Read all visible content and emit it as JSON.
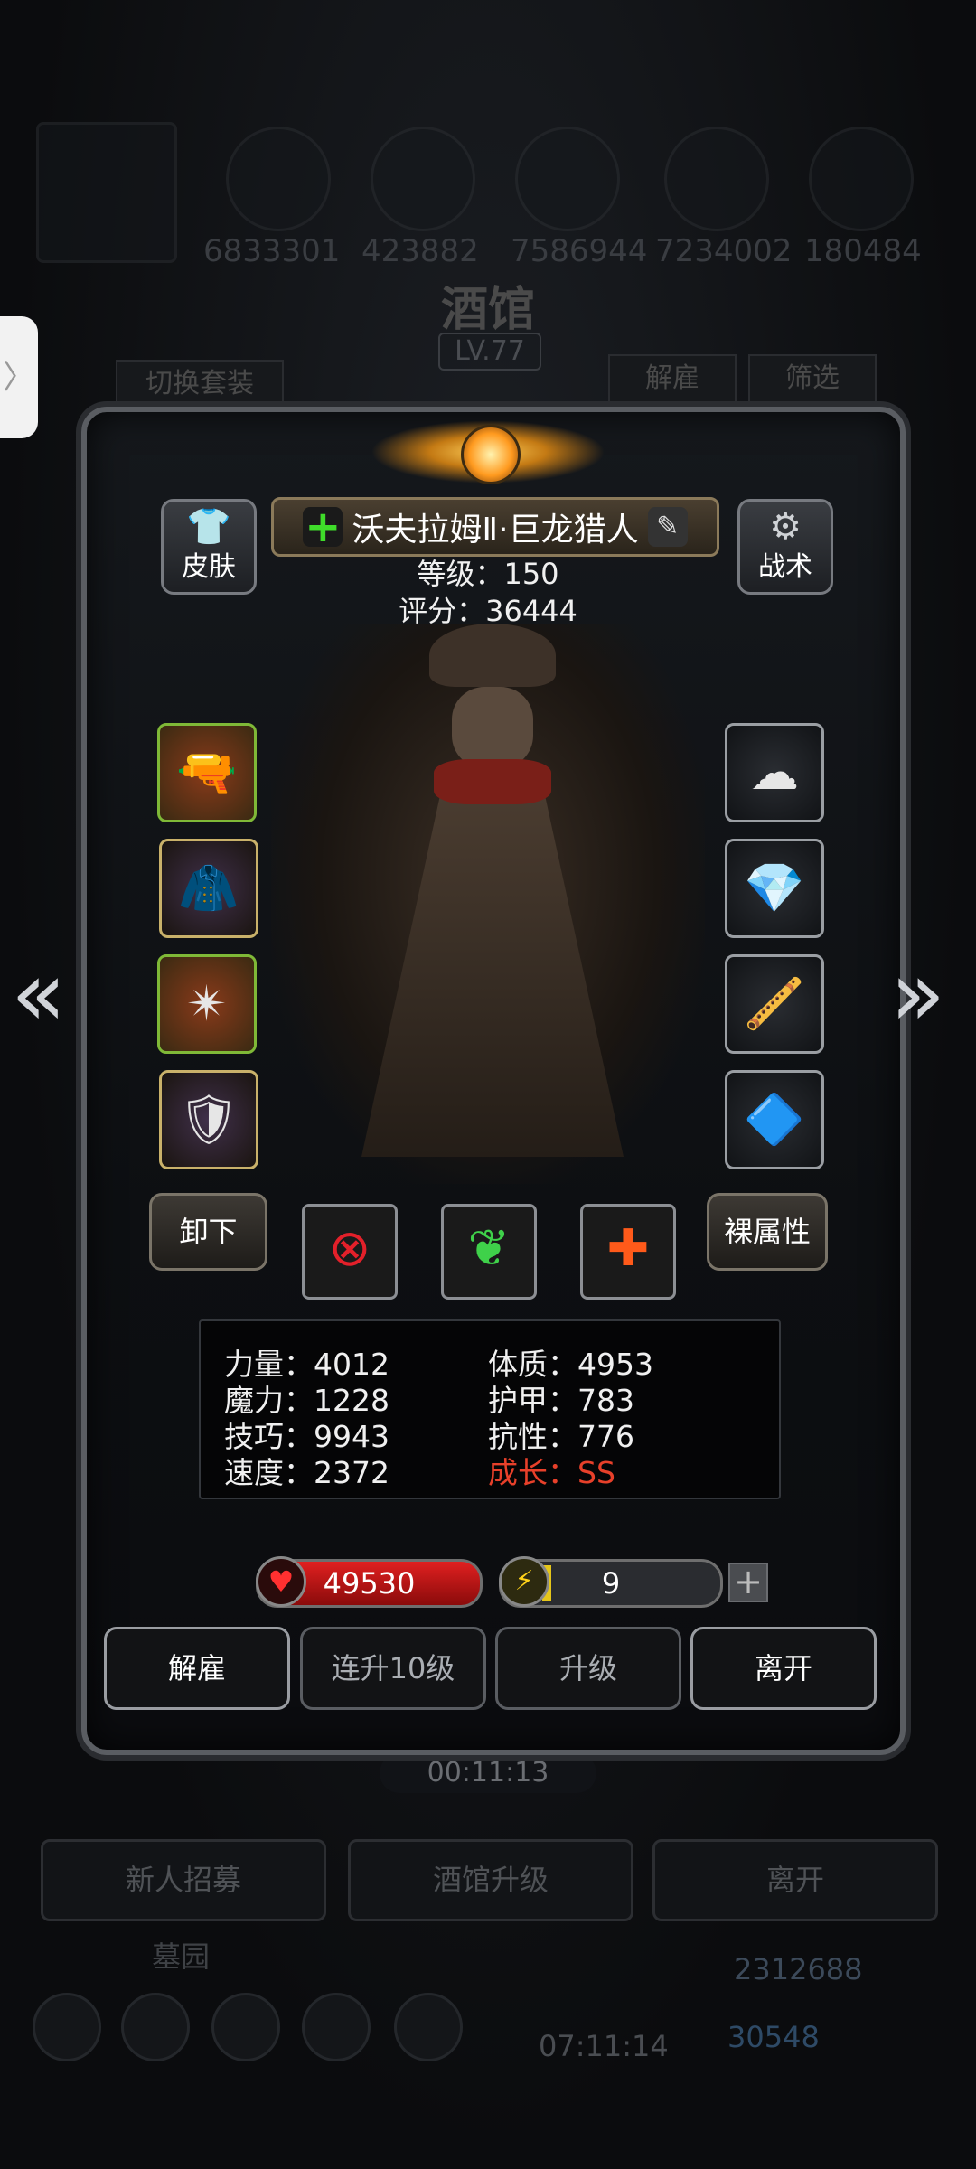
{
  "background": {
    "resource_counts": [
      "6833301",
      "423882",
      "7586944",
      "7234002",
      "180484"
    ],
    "tavern_title": "酒馆",
    "tavern_level": "LV.77",
    "switch_outfit_label": "切换套装",
    "dismiss_label": "解雇",
    "filter_label": "筛选",
    "timer": "00:11:13",
    "recruit_label": "新人招募",
    "upgrade_tavern_label": "酒馆升级",
    "leave_label": "离开",
    "cemetery_label": "墓园",
    "gold": "2312688",
    "gems": "30548",
    "gift_timer": "07:11:14"
  },
  "panel": {
    "skin_label": "皮肤",
    "tactics_label": "战术",
    "hero_name": "沃夫拉姆Ⅱ·巨龙猎人",
    "level_text": "等级：150",
    "score_text": "评分：36444",
    "unequip_label": "卸下",
    "base_attr_label": "裸属性",
    "stats": {
      "strength": "力量：4012",
      "magic": "魔力：1228",
      "skill": "技巧：9943",
      "speed": "速度：2372",
      "constitution": "体质：4953",
      "armor": "护甲：783",
      "resistance": "抗性：776",
      "growth": "成长：SS"
    },
    "hp": "49530",
    "energy": "9",
    "energy_fill_fraction": 0.05,
    "buttons": {
      "dismiss": "解雇",
      "level_up_10": "连升10级",
      "level_up": "升级",
      "leave": "离开"
    }
  },
  "icons": {
    "left_arrow": "«",
    "right_arrow": "»",
    "side_handle": "〉"
  },
  "colors": {
    "growth": "#e8402a",
    "hp_bar": "#e02020",
    "energy_fill": "#e5c61a",
    "plus_icon": "#3fdc2a"
  }
}
